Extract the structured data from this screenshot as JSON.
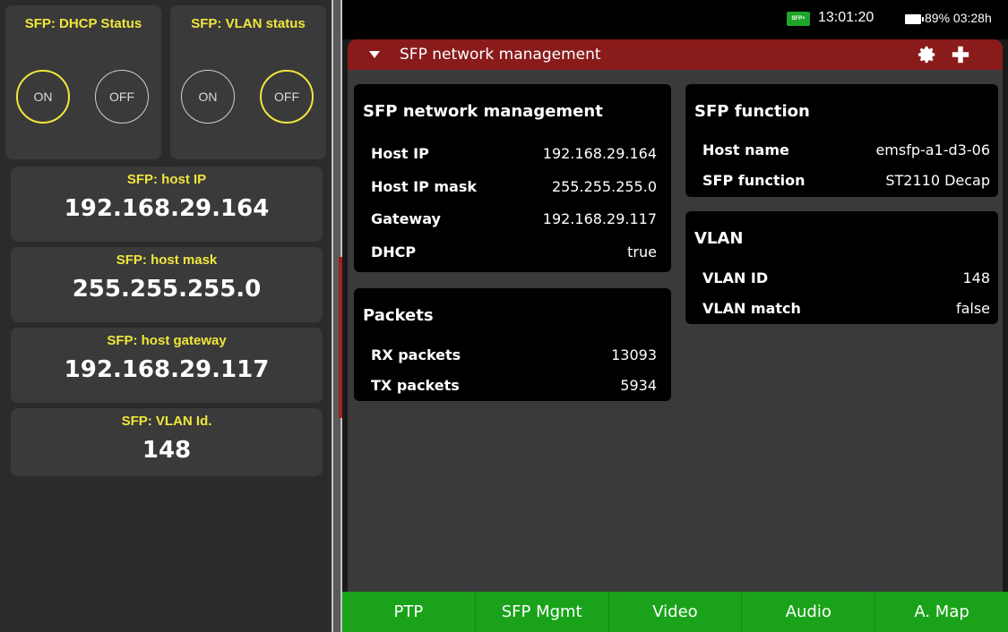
{
  "left": {
    "dhcp_title": "SFP: DHCP Status",
    "vlan_title": "SFP: VLAN status",
    "dhcp_on": "ON",
    "dhcp_off": "OFF",
    "vlan_on": "ON",
    "vlan_off": "OFF",
    "host_ip_title": "SFP: host IP",
    "host_ip_value": "192.168.29.164",
    "host_mask_title": "SFP: host mask",
    "host_mask_value": "255.255.255.0",
    "host_gateway_title": "SFP: host gateway",
    "host_gateway_value": "192.168.29.117",
    "vlan_id_title": "SFP: VLAN Id.",
    "vlan_id_value": "148"
  },
  "status": {
    "sfp_badge": "SFP+",
    "clock": "13:01:20",
    "battery": "89% 03:28h"
  },
  "header": {
    "title": "SFP network management"
  },
  "network": {
    "title": "SFP network management",
    "rows": [
      {
        "label": "Host IP",
        "value": "192.168.29.164"
      },
      {
        "label": "Host IP mask",
        "value": "255.255.255.0"
      },
      {
        "label": "Gateway",
        "value": "192.168.29.117"
      },
      {
        "label": "DHCP",
        "value": "true"
      }
    ]
  },
  "packets": {
    "title": "Packets",
    "rows": [
      {
        "label": "RX packets",
        "value": "13093"
      },
      {
        "label": "TX packets",
        "value": "5934"
      }
    ]
  },
  "function": {
    "title": "SFP function",
    "rows": [
      {
        "label": "Host name",
        "value": "emsfp-a1-d3-06"
      },
      {
        "label": "SFP function",
        "value": "ST2110 Decap"
      }
    ]
  },
  "vlan": {
    "title": "VLAN",
    "rows": [
      {
        "label": "VLAN ID",
        "value": "148"
      },
      {
        "label": "VLAN match",
        "value": "false"
      }
    ]
  },
  "tabs": [
    "PTP",
    "SFP Mgmt",
    "Video",
    "Audio",
    "A. Map"
  ],
  "colors": {
    "accent_yellow": "#f0e63c",
    "header_red": "#8a1b1b",
    "tab_green": "#1aa31a"
  }
}
